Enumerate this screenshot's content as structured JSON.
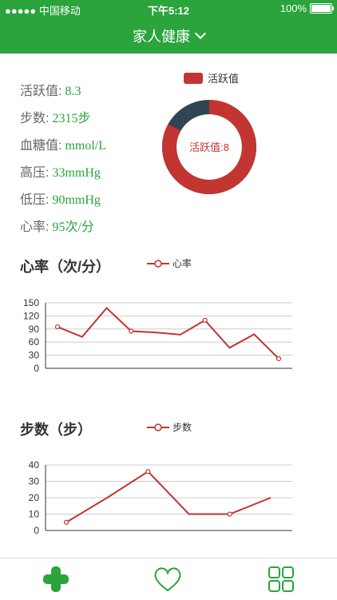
{
  "status_bar": {
    "carrier": "●●●●● 中国移动",
    "time": "下午5:12",
    "battery": "100%",
    "battery_level": 100
  },
  "header": {
    "title": "家人健康"
  },
  "stats": [
    {
      "label": "活跃值:",
      "value": "8.3"
    },
    {
      "label": "步数:",
      "value": "2315步"
    },
    {
      "label": "血糖值:",
      "value": "mmol/L"
    },
    {
      "label": "高压:",
      "value": "33mmHg"
    },
    {
      "label": "低压:",
      "value": "90mmHg"
    },
    {
      "label": "心率:",
      "value": "95次/分"
    }
  ],
  "donut": {
    "legend": "活跃值",
    "center_label": "活跃值:8",
    "active_fraction": 0.83,
    "colors": {
      "active": "#c23531",
      "remaining": "#2f4554"
    }
  },
  "heart_section": {
    "title": "心率（次/分）",
    "legend": "心率"
  },
  "steps_section": {
    "title": "步数（步）",
    "legend": "步数"
  },
  "chart_data": [
    {
      "type": "line",
      "series": [
        {
          "name": "心率",
          "values": [
            95,
            72,
            138,
            85,
            82,
            77,
            110,
            47,
            78,
            22
          ]
        }
      ],
      "ylim": [
        0,
        150
      ],
      "yticks": [
        0,
        30,
        60,
        90,
        120,
        150
      ],
      "grid": true,
      "color": "#c23531"
    },
    {
      "type": "line",
      "series": [
        {
          "name": "步数",
          "values": [
            5,
            20,
            36,
            10,
            10,
            20
          ],
          "point_markers": [
            true,
            false,
            true,
            false,
            true,
            false
          ]
        }
      ],
      "ylim": [
        0,
        40
      ],
      "yticks": [
        0,
        10,
        20,
        30,
        40
      ],
      "grid": true,
      "color": "#c23531"
    }
  ],
  "tabbar": {
    "items": [
      {
        "icon": "plus-icon",
        "color": "#2aa43b"
      },
      {
        "icon": "heart-icon",
        "color": "#2aa43b"
      },
      {
        "icon": "grid-icon",
        "color": "#2aa43b"
      }
    ]
  }
}
